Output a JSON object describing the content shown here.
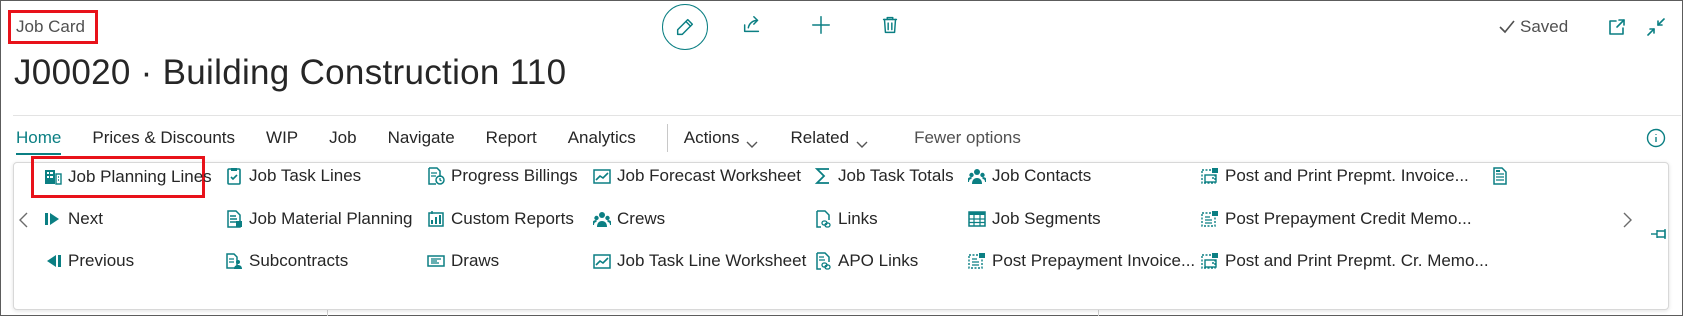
{
  "header": {
    "page_type": "Job Card",
    "title": "J00020 · Building Construction 110",
    "status": "Saved"
  },
  "toolbar": {
    "icons": [
      "edit-pencil-icon",
      "share-icon",
      "add-icon",
      "delete-icon",
      "open-new-window-icon",
      "collapse-icon"
    ]
  },
  "tabs": {
    "home": "Home",
    "prices": "Prices & Discounts",
    "wip": "WIP",
    "job": "Job",
    "navigate": "Navigate",
    "report": "Report",
    "analytics": "Analytics",
    "actions": "Actions",
    "related": "Related",
    "fewer": "Fewer options"
  },
  "actions": {
    "col1": [
      "Job Planning Lines",
      "Next",
      "Previous"
    ],
    "col2": [
      "Job Task Lines",
      "Job Material Planning",
      "Subcontracts"
    ],
    "col3": [
      "Progress Billings",
      "Custom Reports",
      "Draws"
    ],
    "col4": [
      "Job Forecast Worksheet",
      "Crews",
      "Job Task Line Worksheet"
    ],
    "col5": [
      "Job Task Totals",
      "Links",
      "APO Links"
    ],
    "col6": [
      "Job Contacts",
      "Job Segments",
      "Post Prepayment Invoice..."
    ],
    "col7": [
      "Post and Print Prepmt. Invoice...",
      "Post Prepayment Credit Memo...",
      "Post and Print Prepmt. Cr. Memo..."
    ]
  },
  "colors": {
    "accent": "#0b7f83",
    "highlight": "#e8121a"
  }
}
